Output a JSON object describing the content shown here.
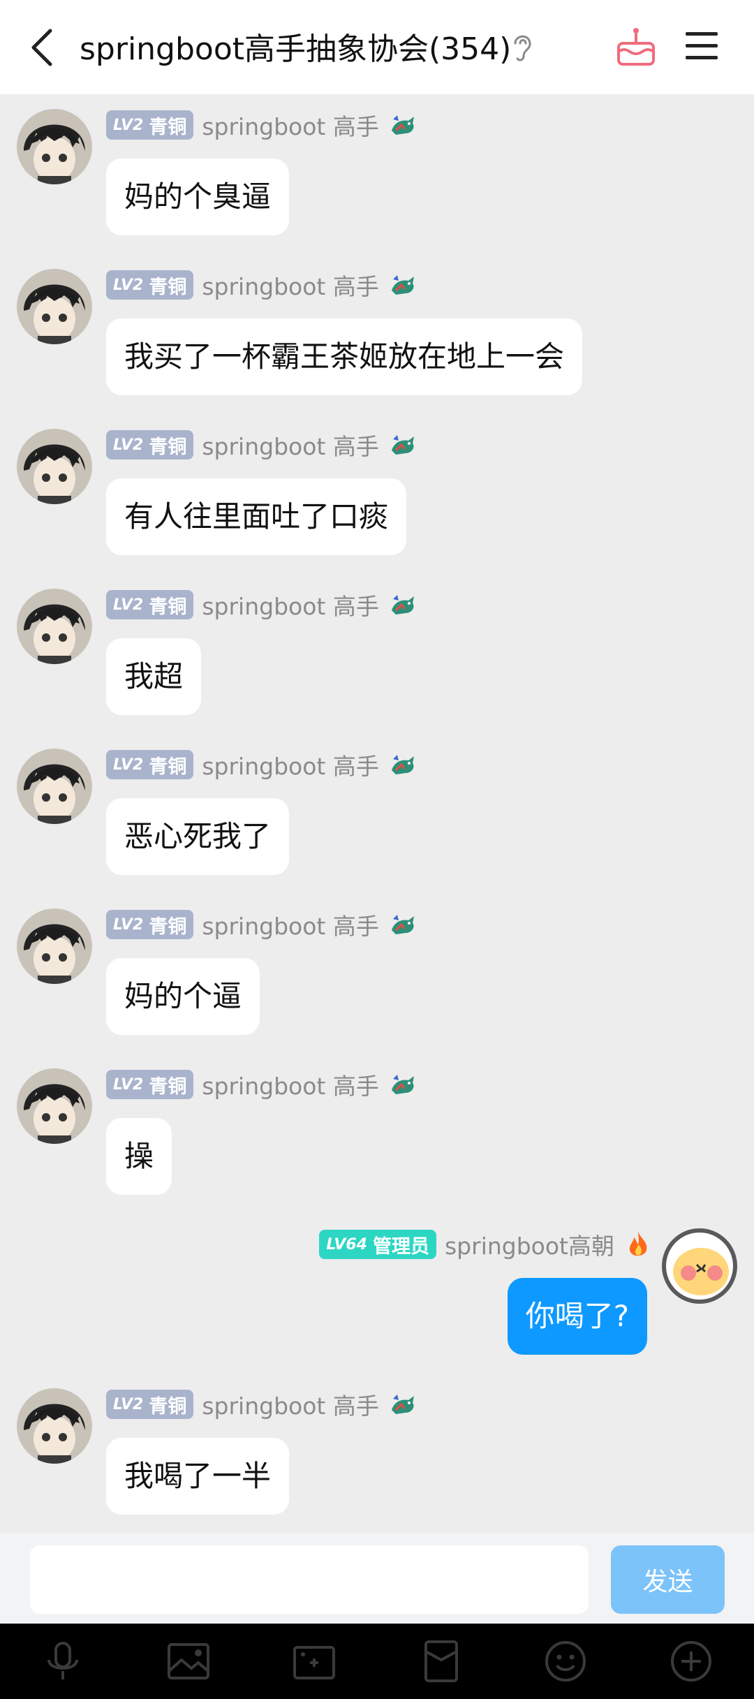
{
  "header": {
    "title": "springboot高手抽象协会(354)"
  },
  "messages": [
    {
      "side": "in",
      "badge_lv": "LV2",
      "badge_title": "青铜",
      "nickname": "springboot 高手",
      "text": "妈的个臭逼"
    },
    {
      "side": "in",
      "badge_lv": "LV2",
      "badge_title": "青铜",
      "nickname": "springboot 高手",
      "text": "我买了一杯霸王茶姬放在地上一会"
    },
    {
      "side": "in",
      "badge_lv": "LV2",
      "badge_title": "青铜",
      "nickname": "springboot 高手",
      "text": "有人往里面吐了口痰"
    },
    {
      "side": "in",
      "badge_lv": "LV2",
      "badge_title": "青铜",
      "nickname": "springboot 高手",
      "text": "我超"
    },
    {
      "side": "in",
      "badge_lv": "LV2",
      "badge_title": "青铜",
      "nickname": "springboot 高手",
      "text": "恶心死我了"
    },
    {
      "side": "in",
      "badge_lv": "LV2",
      "badge_title": "青铜",
      "nickname": "springboot 高手",
      "text": "妈的个逼"
    },
    {
      "side": "in",
      "badge_lv": "LV2",
      "badge_title": "青铜",
      "nickname": "springboot 高手",
      "text": "操"
    },
    {
      "side": "out",
      "badge_lv": "LV64",
      "badge_title": "管理员",
      "nickname": "springboot高朝",
      "text": "你喝了?"
    },
    {
      "side": "in",
      "badge_lv": "LV2",
      "badge_title": "青铜",
      "nickname": "springboot 高手",
      "text": "我喝了一半"
    }
  ],
  "composer": {
    "placeholder": "",
    "send_label": "发送"
  },
  "toolbar": {
    "icons": [
      "microphone-icon",
      "image-icon",
      "camera-icon",
      "red-packet-icon",
      "emoji-icon",
      "plus-icon"
    ]
  },
  "colors": {
    "header_bg": "#ffffff",
    "chat_bg": "#ededed",
    "bubble_in": "#ffffff",
    "bubble_out": "#0d99ff",
    "badge_bronze": "#a9b3cc",
    "badge_admin": "#2dd6c3",
    "send_button": "#7cc3fa",
    "toolbar_bg": "#000000"
  }
}
